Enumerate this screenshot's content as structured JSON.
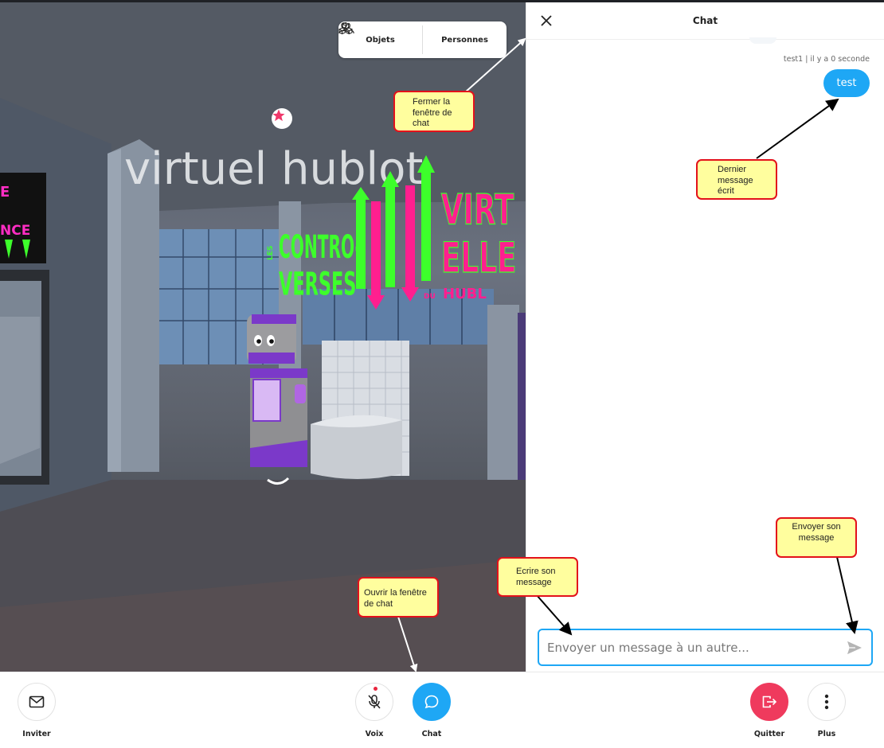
{
  "scene": {
    "menu": {
      "objects_label": "Objets",
      "people_label": "Personnes"
    },
    "hub_title": "virtuel hublot",
    "signage": {
      "left_banner_lines": [
        "E",
        "NCE"
      ],
      "controverses_small": "LES",
      "controverses_line1": "CONTRO-",
      "controverses_line2": "VERSES",
      "virtuelles_line1": "VIRT",
      "virtuelles_line2": "ELLE",
      "hubl_prefix": "DU",
      "hubl_text": "HUBL"
    }
  },
  "chat": {
    "title": "Chat",
    "messages": [
      {
        "meta": "test1 | il y a 0 seconde",
        "text": "test"
      }
    ],
    "composer_placeholder": "Envoyer un message à un autre..."
  },
  "bottom_bar": {
    "invite_label": "Inviter",
    "voice_label": "Voix",
    "chat_label": "Chat",
    "quit_label": "Quitter",
    "more_label": "Plus"
  },
  "annotations": {
    "close_chat": "Fermer la fenêtre de chat",
    "last_message": "Dernier message écrit",
    "send_message": "Envoyer son message",
    "write_message": "Ecrire son message",
    "open_chat": "Ouvrir la fenêtre de chat"
  },
  "colors": {
    "accent_blue": "#1ea7f5",
    "quit_red": "#ef3a5d",
    "note_fill": "#fffe9e",
    "note_border": "#e3111b",
    "neon_green": "#3dff2b",
    "neon_magenta": "#ff1f8f"
  },
  "icons": {
    "objects": "cubes-icon",
    "people": "people-icon",
    "close": "close-icon",
    "send": "send-icon",
    "invite": "mail-icon",
    "voice": "mic-off-icon",
    "chat": "chat-bubble-icon",
    "quit": "exit-icon",
    "more": "vertical-dots-icon",
    "favorite": "star-icon"
  }
}
